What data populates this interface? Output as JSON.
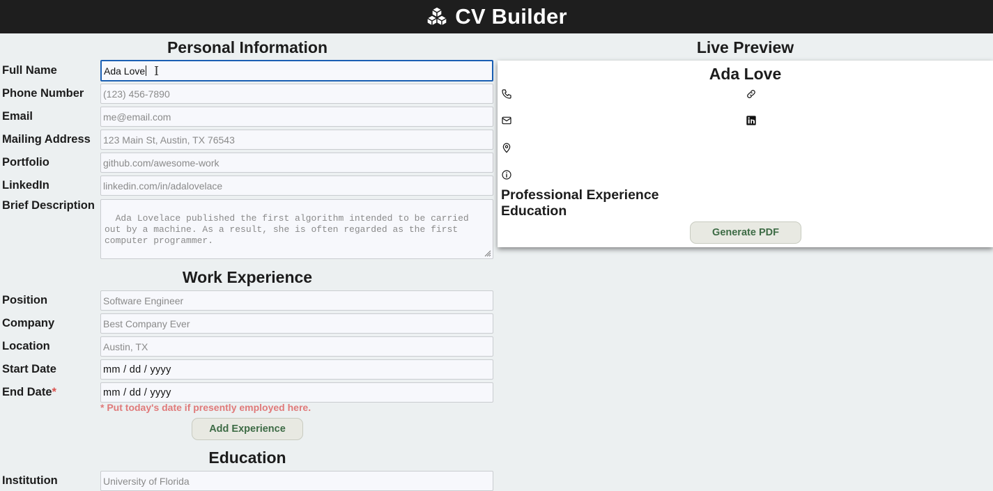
{
  "app": {
    "title": "CV Builder",
    "logo_icon": "cubes-icon"
  },
  "personal": {
    "heading": "Personal Information",
    "full_name": {
      "label": "Full Name",
      "value": "Ada Love"
    },
    "phone": {
      "label": "Phone Number",
      "placeholder": "(123) 456-7890"
    },
    "email": {
      "label": "Email",
      "placeholder": "me@email.com"
    },
    "address": {
      "label": "Mailing Address",
      "placeholder": "123 Main St, Austin, TX 76543"
    },
    "portfolio": {
      "label": "Portfolio",
      "placeholder": "github.com/awesome-work"
    },
    "linkedin": {
      "label": "LinkedIn",
      "placeholder": "linkedin.com/in/adalovelace"
    },
    "description": {
      "label": "Brief Description",
      "placeholder": "Ada Lovelace published the first algorithm intended to be carried out by a machine. As a result, she is often regarded as the first computer programmer."
    }
  },
  "work": {
    "heading": "Work Experience",
    "position": {
      "label": "Position",
      "placeholder": "Software Engineer"
    },
    "company": {
      "label": "Company",
      "placeholder": "Best Company Ever"
    },
    "location": {
      "label": "Location",
      "placeholder": "Austin, TX"
    },
    "start_date": {
      "label": "Start Date",
      "value": "mm / dd / yyyy"
    },
    "end_date": {
      "label": "End Date",
      "required_mark": "*",
      "value": "mm / dd / yyyy"
    },
    "note": "* Put today's date if presently employed here.",
    "add_button": "Add Experience"
  },
  "education": {
    "heading": "Education",
    "institution": {
      "label": "Institution",
      "placeholder": "University of Florida"
    }
  },
  "preview": {
    "heading": "Live Preview",
    "name": "Ada Love",
    "icons": [
      "phone-icon",
      "link-icon",
      "mail-icon",
      "linkedin-icon",
      "location-pin-icon",
      "info-icon"
    ],
    "section_experience": "Professional Experience",
    "section_education": "Education",
    "generate_button": "Generate PDF"
  }
}
